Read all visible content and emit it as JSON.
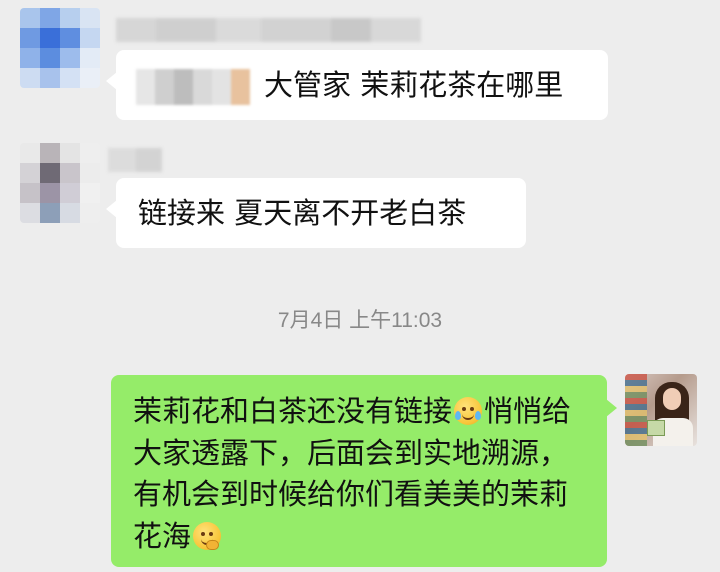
{
  "messages": {
    "first": {
      "sender_name_obscured": true,
      "mention_obscured": true,
      "text": "大管家  茉莉花茶在哪里"
    },
    "second": {
      "sender_name_obscured": true,
      "text": "链接来   夏天离不开老白茶"
    },
    "timestamp": "7月4日 上午11:03",
    "outgoing": {
      "part1": "茉莉花和白茶还没有链接",
      "emoji1": "crying-laughing-emoji",
      "part2": "悄悄给大家透露下，后面会到实地溯源，有机会到时候给你们看美美的茉莉花海",
      "emoji2": "shy-smile-emoji"
    }
  },
  "colors": {
    "background": "#ededed",
    "incoming_bubble": "#ffffff",
    "outgoing_bubble": "#95ec69",
    "timestamp_text": "#888888"
  }
}
